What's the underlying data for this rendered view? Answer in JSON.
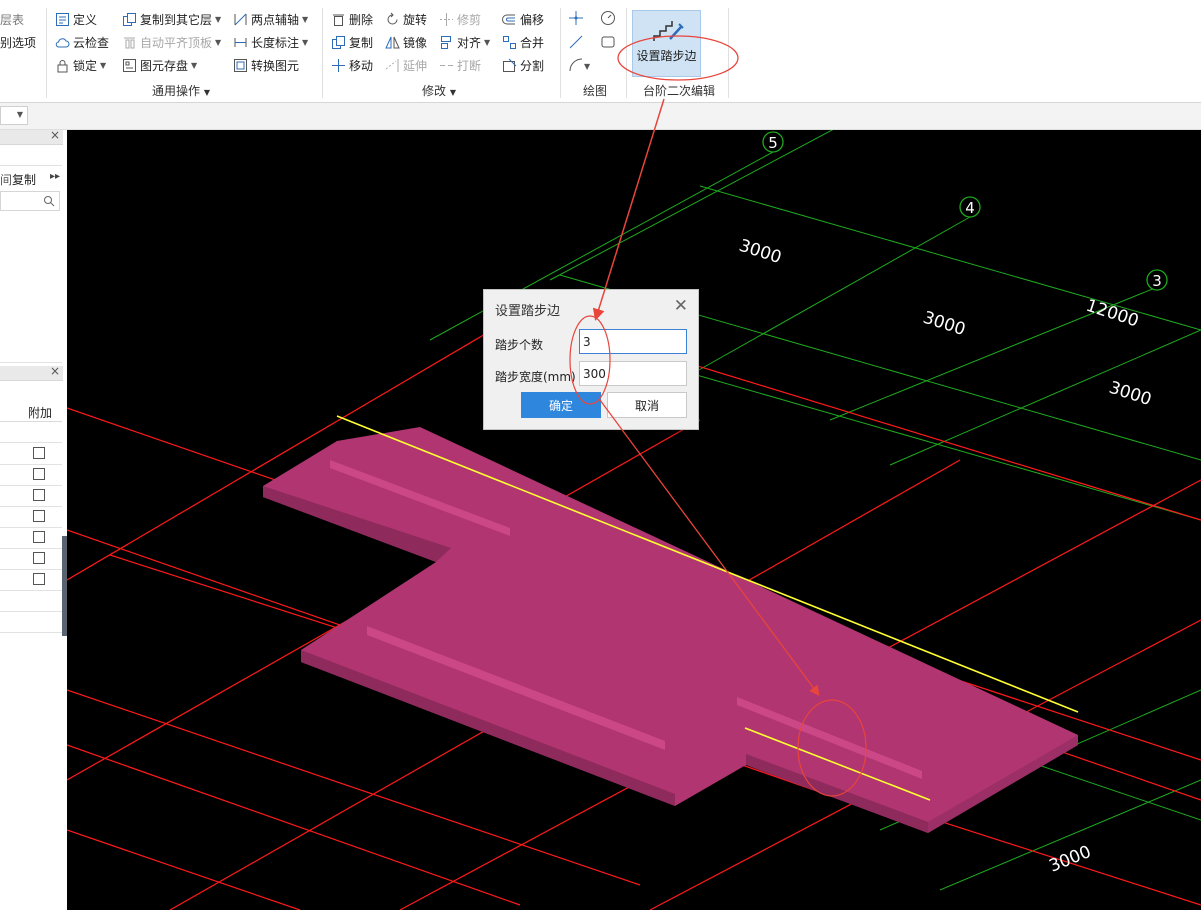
{
  "ribbon": {
    "partial_left": {
      "item1": "层表",
      "item2": "别选项"
    },
    "general_ops": {
      "define": "定义",
      "cloud_check": "云检查",
      "lock": "锁定",
      "copy_to_other_floor": "复制到其它层",
      "auto_flush_top": "自动平齐顶板",
      "save_element": "图元存盘",
      "two_point_aux": "两点辅轴",
      "length_dim": "长度标注",
      "convert_element": "转换图元",
      "group_label": "通用操作"
    },
    "modify": {
      "delete": "删除",
      "rotate": "旋转",
      "trim": "修剪",
      "offset": "偏移",
      "copy": "复制",
      "mirror": "镜像",
      "align": "对齐",
      "merge": "合并",
      "move": "移动",
      "extend": "延伸",
      "break": "打断",
      "split": "分割",
      "group_label": "修改"
    },
    "draw": {
      "group_label": "绘图"
    },
    "step_edit": {
      "button_label": "设置踏步边",
      "group_label": "台阶二次编辑"
    }
  },
  "left_panel": {
    "copy_label": "复制",
    "attach_header": "附加",
    "checkbox_count": 7
  },
  "dialog": {
    "title": "设置踏步边",
    "step_count_label": "踏步个数",
    "step_count_value": "3",
    "step_width_label": "踏步宽度(mm)",
    "step_width_value": "300",
    "ok_label": "确定",
    "cancel_label": "取消"
  },
  "viewport": {
    "axes": [
      "5",
      "4",
      "3"
    ],
    "dimensions": [
      "3000",
      "3000",
      "12000",
      "3000",
      "3000"
    ]
  },
  "colors": {
    "viewport_bg": "#000000",
    "grid_red": "#ff1a1a",
    "grid_green": "#1faa1f",
    "slab_fill": "#b03570",
    "edge_yellow": "#ffff33",
    "accent_blue": "#2f86dd",
    "annotation_red": "#e8453c"
  },
  "icons": [
    "define-icon",
    "cloud-check-icon",
    "lock-icon",
    "copy-floor-icon",
    "auto-flush-icon",
    "save-element-icon",
    "two-point-aux-icon",
    "length-dim-icon",
    "convert-icon",
    "delete-icon",
    "rotate-icon",
    "trim-icon",
    "offset-icon",
    "copy-icon",
    "mirror-icon",
    "align-icon",
    "merge-icon",
    "move-icon",
    "extend-icon",
    "break-icon",
    "split-icon",
    "point-icon",
    "measure-icon",
    "line-icon",
    "rect-icon",
    "arc-icon",
    "stair-edit-icon",
    "search-icon",
    "close-icon"
  ]
}
